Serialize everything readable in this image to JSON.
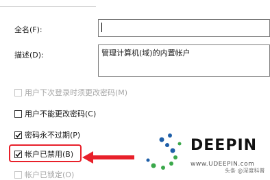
{
  "form": {
    "fullname_label": "全名(F):",
    "fullname_value": "",
    "description_label": "描述(D):",
    "description_value": "管理计算机(域)的内置帐户"
  },
  "options": [
    {
      "label": "用户下次登录时须更改密码(M)",
      "checked": false,
      "disabled": true
    },
    {
      "label": "用户不能更改密码(C)",
      "checked": false,
      "disabled": false
    },
    {
      "label": "密码永不过期(P)",
      "checked": true,
      "disabled": false
    },
    {
      "label": "帐户已禁用(B)",
      "checked": true,
      "disabled": false
    },
    {
      "label": "帐户已锁定(O)",
      "checked": false,
      "disabled": true
    }
  ],
  "colors": {
    "highlight": "#e8202a",
    "logo_blue": "#1f5fa8",
    "logo_green": "#3aa84a"
  },
  "overlay": {
    "logo_text": "DEEPIN",
    "logo_url": "www.UDEEPIN.com",
    "watermark": "头条 @深度科普"
  }
}
